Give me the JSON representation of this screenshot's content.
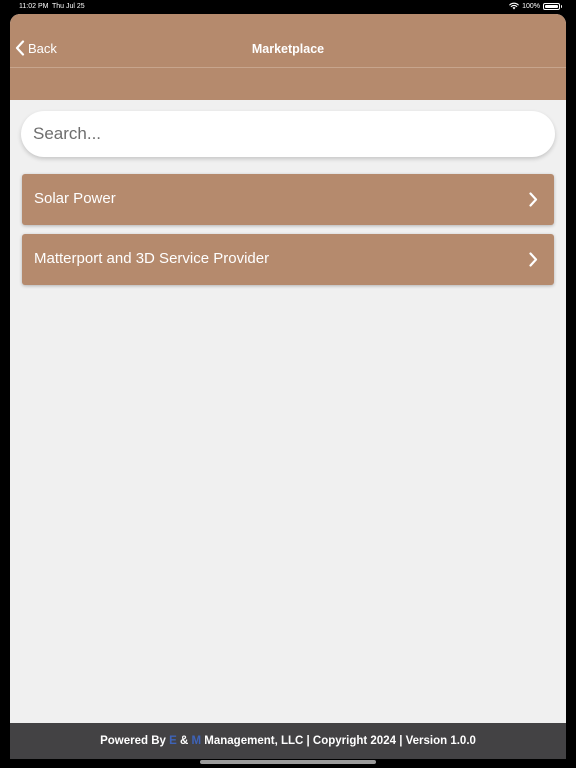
{
  "status_bar": {
    "time": "11:02 PM",
    "date": "Thu Jul 25",
    "battery": "100%",
    "wifi_icon": "wifi-icon",
    "battery_icon": "battery-icon"
  },
  "nav": {
    "back_label": "Back",
    "back_icon": "chevron-left-icon",
    "title": "Marketplace"
  },
  "search": {
    "placeholder": "Search...",
    "value": ""
  },
  "categories": [
    {
      "label": "Solar Power",
      "icon": "chevron-right-icon"
    },
    {
      "label": "Matterport and 3D Service Provider",
      "icon": "chevron-right-icon"
    }
  ],
  "footer": {
    "prefix": "Powered By ",
    "accent_1": "E",
    "ampersand": " & ",
    "accent_2": "M",
    "suffix": " Management, LLC | Copyright 2024 | Version 1.0.0"
  },
  "colors": {
    "brand": "#b58a6d",
    "background": "#f0f0f0",
    "footer": "#434244",
    "accent": "#3e63b8"
  }
}
